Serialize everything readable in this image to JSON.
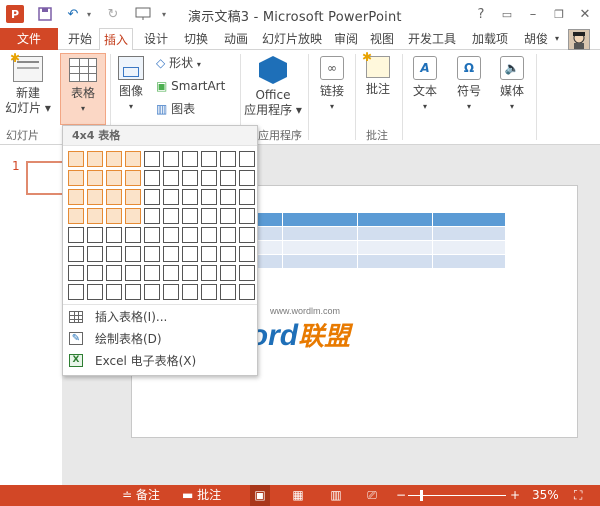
{
  "window": {
    "title": "演示文稿3 - Microsoft PowerPoint",
    "user_name": "胡俊"
  },
  "tabs": [
    "文件",
    "开始",
    "插入",
    "设计",
    "切换",
    "动画",
    "幻灯片放映",
    "审阅",
    "视图",
    "开发工具",
    "加载项"
  ],
  "ribbon": {
    "new_slide": [
      "新建",
      "幻灯片"
    ],
    "table": "表格",
    "image": "图像",
    "shapes": "形状",
    "smartart": "SmartArt",
    "chart": "图表",
    "office_apps": [
      "Office",
      "应用程序"
    ],
    "link": "链接",
    "comment": "批注",
    "text": "文本",
    "symbol": "符号",
    "media": "媒体",
    "groups": {
      "slides": "幻灯片",
      "apps": "应用程序",
      "comments": "批注"
    }
  },
  "table_dropdown": {
    "header": "4x4 表格",
    "grid": {
      "cols": 10,
      "rows": 8,
      "selected_cols": 4,
      "selected_rows": 4
    },
    "items": [
      {
        "label": "插入表格(I)...",
        "icon": "insert-table-icon"
      },
      {
        "label": "绘制表格(D)",
        "icon": "draw-table-icon"
      },
      {
        "label": "Excel 电子表格(X)",
        "icon": "excel-sheet-icon"
      }
    ]
  },
  "thumbnail": {
    "number": "1"
  },
  "watermark": {
    "brand_a": "Word",
    "brand_b": "联盟",
    "url": "www.wordlm.com"
  },
  "status": {
    "notes": "备注",
    "comments": "批注",
    "zoom": "35%"
  },
  "colors": {
    "accent": "#d24726",
    "table_header": "#5b9bd5"
  }
}
